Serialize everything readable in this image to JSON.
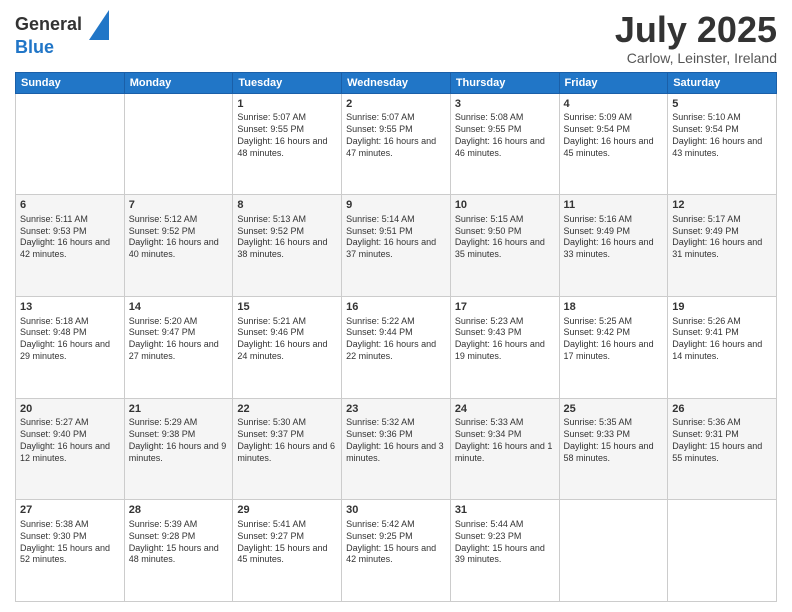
{
  "header": {
    "logo_line1": "General",
    "logo_line2": "Blue",
    "month_title": "July 2025",
    "location": "Carlow, Leinster, Ireland"
  },
  "days_of_week": [
    "Sunday",
    "Monday",
    "Tuesday",
    "Wednesday",
    "Thursday",
    "Friday",
    "Saturday"
  ],
  "weeks": [
    [
      {
        "day": "",
        "info": ""
      },
      {
        "day": "",
        "info": ""
      },
      {
        "day": "1",
        "info": "Sunrise: 5:07 AM\nSunset: 9:55 PM\nDaylight: 16 hours\nand 48 minutes."
      },
      {
        "day": "2",
        "info": "Sunrise: 5:07 AM\nSunset: 9:55 PM\nDaylight: 16 hours\nand 47 minutes."
      },
      {
        "day": "3",
        "info": "Sunrise: 5:08 AM\nSunset: 9:55 PM\nDaylight: 16 hours\nand 46 minutes."
      },
      {
        "day": "4",
        "info": "Sunrise: 5:09 AM\nSunset: 9:54 PM\nDaylight: 16 hours\nand 45 minutes."
      },
      {
        "day": "5",
        "info": "Sunrise: 5:10 AM\nSunset: 9:54 PM\nDaylight: 16 hours\nand 43 minutes."
      }
    ],
    [
      {
        "day": "6",
        "info": "Sunrise: 5:11 AM\nSunset: 9:53 PM\nDaylight: 16 hours\nand 42 minutes."
      },
      {
        "day": "7",
        "info": "Sunrise: 5:12 AM\nSunset: 9:52 PM\nDaylight: 16 hours\nand 40 minutes."
      },
      {
        "day": "8",
        "info": "Sunrise: 5:13 AM\nSunset: 9:52 PM\nDaylight: 16 hours\nand 38 minutes."
      },
      {
        "day": "9",
        "info": "Sunrise: 5:14 AM\nSunset: 9:51 PM\nDaylight: 16 hours\nand 37 minutes."
      },
      {
        "day": "10",
        "info": "Sunrise: 5:15 AM\nSunset: 9:50 PM\nDaylight: 16 hours\nand 35 minutes."
      },
      {
        "day": "11",
        "info": "Sunrise: 5:16 AM\nSunset: 9:49 PM\nDaylight: 16 hours\nand 33 minutes."
      },
      {
        "day": "12",
        "info": "Sunrise: 5:17 AM\nSunset: 9:49 PM\nDaylight: 16 hours\nand 31 minutes."
      }
    ],
    [
      {
        "day": "13",
        "info": "Sunrise: 5:18 AM\nSunset: 9:48 PM\nDaylight: 16 hours\nand 29 minutes."
      },
      {
        "day": "14",
        "info": "Sunrise: 5:20 AM\nSunset: 9:47 PM\nDaylight: 16 hours\nand 27 minutes."
      },
      {
        "day": "15",
        "info": "Sunrise: 5:21 AM\nSunset: 9:46 PM\nDaylight: 16 hours\nand 24 minutes."
      },
      {
        "day": "16",
        "info": "Sunrise: 5:22 AM\nSunset: 9:44 PM\nDaylight: 16 hours\nand 22 minutes."
      },
      {
        "day": "17",
        "info": "Sunrise: 5:23 AM\nSunset: 9:43 PM\nDaylight: 16 hours\nand 19 minutes."
      },
      {
        "day": "18",
        "info": "Sunrise: 5:25 AM\nSunset: 9:42 PM\nDaylight: 16 hours\nand 17 minutes."
      },
      {
        "day": "19",
        "info": "Sunrise: 5:26 AM\nSunset: 9:41 PM\nDaylight: 16 hours\nand 14 minutes."
      }
    ],
    [
      {
        "day": "20",
        "info": "Sunrise: 5:27 AM\nSunset: 9:40 PM\nDaylight: 16 hours\nand 12 minutes."
      },
      {
        "day": "21",
        "info": "Sunrise: 5:29 AM\nSunset: 9:38 PM\nDaylight: 16 hours\nand 9 minutes."
      },
      {
        "day": "22",
        "info": "Sunrise: 5:30 AM\nSunset: 9:37 PM\nDaylight: 16 hours\nand 6 minutes."
      },
      {
        "day": "23",
        "info": "Sunrise: 5:32 AM\nSunset: 9:36 PM\nDaylight: 16 hours\nand 3 minutes."
      },
      {
        "day": "24",
        "info": "Sunrise: 5:33 AM\nSunset: 9:34 PM\nDaylight: 16 hours\nand 1 minute."
      },
      {
        "day": "25",
        "info": "Sunrise: 5:35 AM\nSunset: 9:33 PM\nDaylight: 15 hours\nand 58 minutes."
      },
      {
        "day": "26",
        "info": "Sunrise: 5:36 AM\nSunset: 9:31 PM\nDaylight: 15 hours\nand 55 minutes."
      }
    ],
    [
      {
        "day": "27",
        "info": "Sunrise: 5:38 AM\nSunset: 9:30 PM\nDaylight: 15 hours\nand 52 minutes."
      },
      {
        "day": "28",
        "info": "Sunrise: 5:39 AM\nSunset: 9:28 PM\nDaylight: 15 hours\nand 48 minutes."
      },
      {
        "day": "29",
        "info": "Sunrise: 5:41 AM\nSunset: 9:27 PM\nDaylight: 15 hours\nand 45 minutes."
      },
      {
        "day": "30",
        "info": "Sunrise: 5:42 AM\nSunset: 9:25 PM\nDaylight: 15 hours\nand 42 minutes."
      },
      {
        "day": "31",
        "info": "Sunrise: 5:44 AM\nSunset: 9:23 PM\nDaylight: 15 hours\nand 39 minutes."
      },
      {
        "day": "",
        "info": ""
      },
      {
        "day": "",
        "info": ""
      }
    ]
  ]
}
